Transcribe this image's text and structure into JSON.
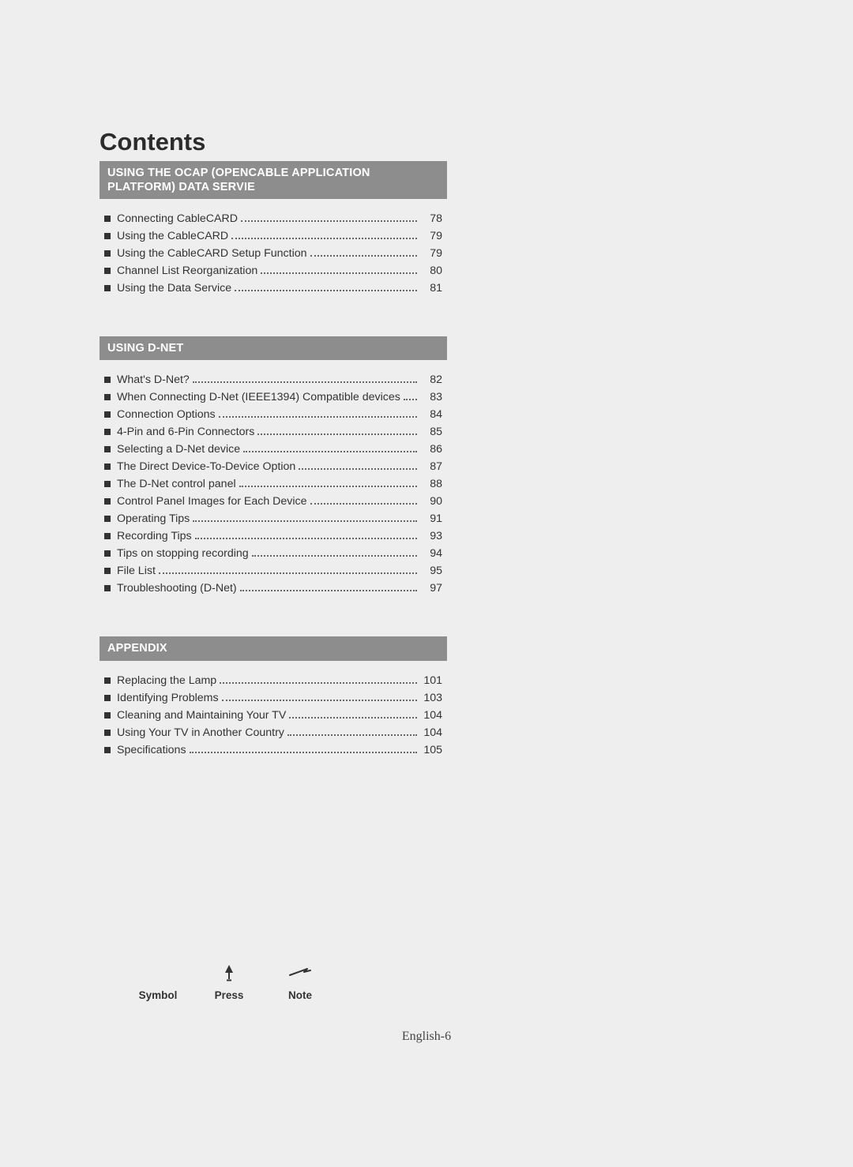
{
  "title": "Contents",
  "sections": [
    {
      "heading": "USING THE OCAP (OPENCABLE APPLICATION PLATFORM) DATA SERVIE",
      "items": [
        {
          "label": "Connecting CableCARD",
          "page": "78"
        },
        {
          "label": "Using the CableCARD",
          "page": "79"
        },
        {
          "label": "Using the CableCARD Setup Function",
          "page": "79"
        },
        {
          "label": "Channel List Reorganization",
          "page": "80"
        },
        {
          "label": "Using the Data Service",
          "page": "81"
        }
      ]
    },
    {
      "heading": "USING D-NET",
      "items": [
        {
          "label": "What's D-Net?",
          "page": "82"
        },
        {
          "label": "When Connecting D-Net (IEEE1394) Compatible devices",
          "page": "83"
        },
        {
          "label": "Connection Options",
          "page": "84"
        },
        {
          "label": "4-Pin and 6-Pin Connectors",
          "page": "85"
        },
        {
          "label": "Selecting a D-Net device",
          "page": "86"
        },
        {
          "label": "The Direct Device-To-Device Option",
          "page": "87"
        },
        {
          "label": "The D-Net control panel",
          "page": "88"
        },
        {
          "label": "Control Panel Images for Each Device",
          "page": "90"
        },
        {
          "label": "Operating Tips",
          "page": "91"
        },
        {
          "label": "Recording Tips",
          "page": "93"
        },
        {
          "label": "Tips on stopping recording",
          "page": "94"
        },
        {
          "label": "File List",
          "page": "95"
        },
        {
          "label": "Troubleshooting (D-Net)",
          "page": "97"
        }
      ]
    },
    {
      "heading": "APPENDIX",
      "items": [
        {
          "label": "Replacing the Lamp",
          "page": "101"
        },
        {
          "label": "Identifying Problems",
          "page": "103"
        },
        {
          "label": "Cleaning and Maintaining Your TV",
          "page": "104"
        },
        {
          "label": "Using Your TV in Another Country",
          "page": "104"
        },
        {
          "label": "Specifications",
          "page": "105"
        }
      ]
    }
  ],
  "legend": {
    "symbol": "Symbol",
    "press": "Press",
    "note": "Note"
  },
  "footer": "English-6"
}
